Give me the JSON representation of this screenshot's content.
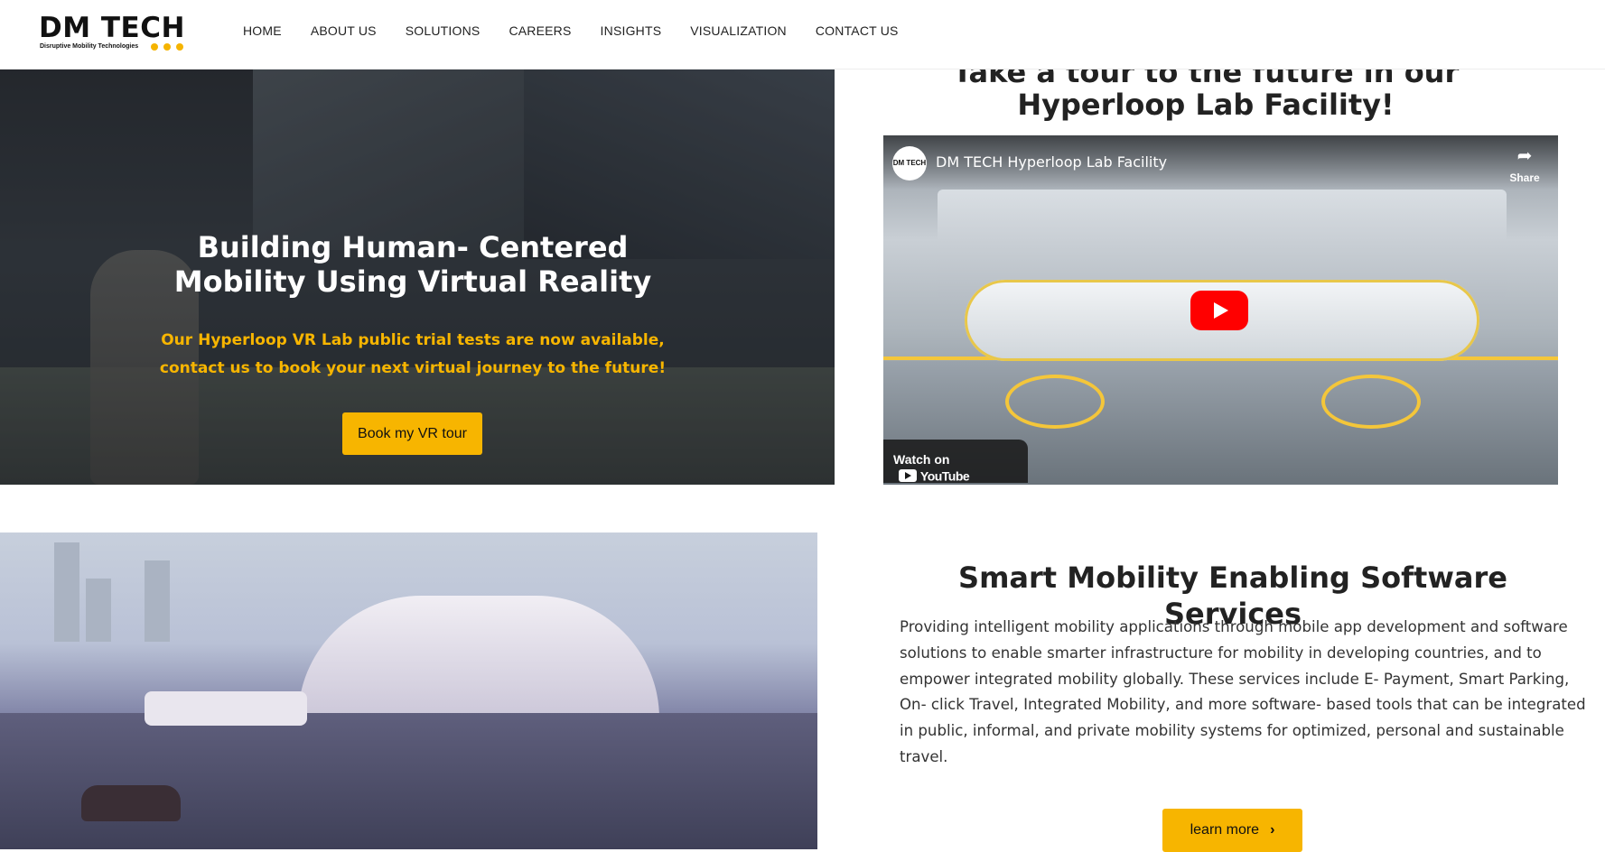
{
  "header": {
    "logo_text": "DM TECH",
    "logo_tagline": "Disruptive Mobility Technologies",
    "nav": [
      "HOME",
      "ABOUT US",
      "SOLUTIONS",
      "CAREERS",
      "INSIGHTS",
      "VISUALIZATION",
      "CONTACT US"
    ]
  },
  "hero": {
    "title": "Building Human- Centered Mobility Using Virtual Reality",
    "subtitle": "Our Hyperloop VR Lab public trial tests are now available, contact us to book your next virtual journey to the future!",
    "button": "Book my VR tour"
  },
  "tour": {
    "title": "Take a tour to the future in our Hyperloop Lab Facility!"
  },
  "video": {
    "channel_avatar": "DM TECH",
    "title": "DM TECH Hyperloop Lab Facility",
    "share": "Share",
    "watch_on": "Watch on",
    "youtube": "YouTube"
  },
  "services": {
    "title": "Smart Mobility Enabling Software Services",
    "body": "Providing intelligent mobility applications through mobile app development and software solutions to enable smarter infrastructure for mobility in developing countries, and to empower integrated mobility globally. These services include E- Payment, Smart Parking, On- click Travel, Integrated Mobility, and more software- based tools that can be integrated in public, informal, and private mobility systems for optimized, personal and sustainable travel.",
    "button": "learn more"
  },
  "colors": {
    "accent": "#f7b500",
    "youtube_red": "#ff0000"
  },
  "icons": {
    "share": "share-arrow-icon",
    "play": "play-icon",
    "chevron": "chevron-right-icon"
  }
}
